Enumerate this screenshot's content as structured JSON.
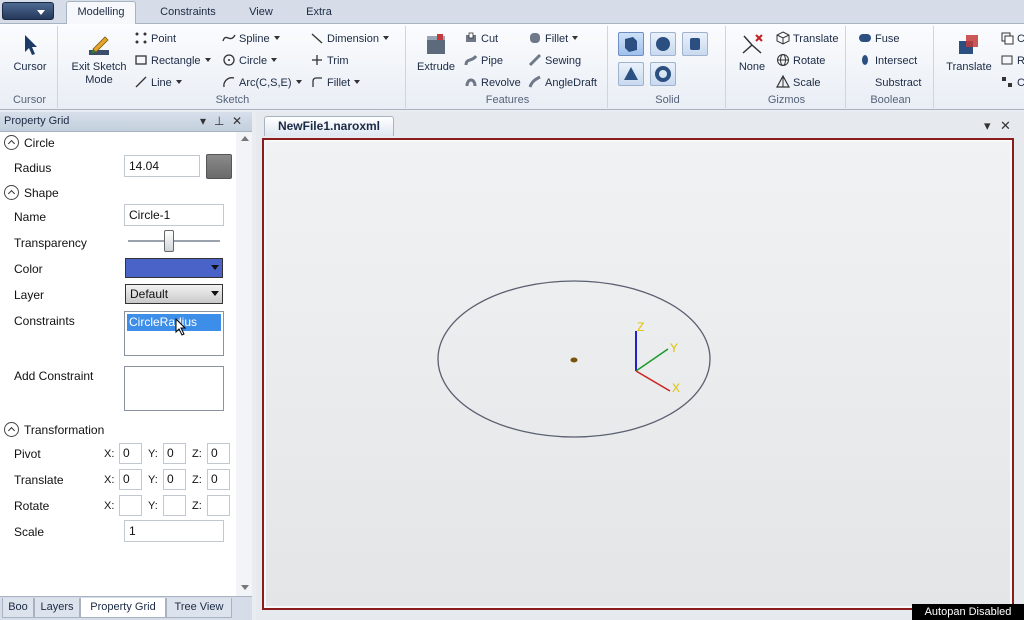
{
  "tabs": [
    "Modelling",
    "Constraints",
    "View",
    "Extra"
  ],
  "ribbon": {
    "cursor": {
      "button": "Cursor",
      "group": "Cursor"
    },
    "sketch": {
      "group": "Sketch",
      "exit_line1": "Exit Sketch",
      "exit_line2": "Mode",
      "point": "Point",
      "rectangle": "Rectangle",
      "line": "Line",
      "spline": "Spline",
      "circle": "Circle",
      "arc": "Arc(C,S,E)",
      "dimension": "Dimension",
      "trim": "Trim",
      "fillet": "Fillet"
    },
    "features": {
      "group": "Features",
      "extrude": "Extrude",
      "cut": "Cut",
      "pipe": "Pipe",
      "revolve": "Revolve",
      "fillet": "Fillet",
      "sewing": "Sewing",
      "angledraft": "AngleDraft"
    },
    "solid": {
      "group": "Solid"
    },
    "gizmos": {
      "group": "Gizmos",
      "none": "None",
      "translate": "Translate",
      "rotate": "Rotate",
      "scale": "Scale"
    },
    "boolean": {
      "group": "Boolean",
      "fuse": "Fuse",
      "intersect": "Intersect",
      "substract": "Substract"
    },
    "extra": {
      "translate": "Translate",
      "c1": "C",
      "c2": "R",
      "c3": "C"
    }
  },
  "property_grid": {
    "title": "Property Grid",
    "circle_section": "Circle",
    "radius_label": "Radius",
    "radius_value": "14.04",
    "shape_section": "Shape",
    "name_label": "Name",
    "name_value": "Circle-1",
    "transparency_label": "Transparency",
    "transparency": 0.45,
    "color_label": "Color",
    "color_value": "#4a63c9",
    "layer_label": "Layer",
    "layer_value": "Default",
    "constraints_label": "Constraints",
    "constraints_item": "CircleRadius",
    "add_constraint_label": "Add Constraint",
    "transformation_section": "Transformation",
    "pivot_label": "Pivot",
    "translate_label": "Translate",
    "rotate_label": "Rotate",
    "scale_label": "Scale",
    "axis_x": "X:",
    "axis_y": "Y:",
    "axis_z": "Z:",
    "pivot": [
      "0",
      "0",
      "0"
    ],
    "translate": [
      "0",
      "0",
      "0"
    ],
    "rotate": [
      "",
      "",
      ""
    ],
    "scale_value": "1"
  },
  "bottom_tabs": [
    "Boo",
    "Layers",
    "Property Grid",
    "Tree View"
  ],
  "document": {
    "tab": "NewFile1.naroxml",
    "axis_x": "X",
    "axis_y": "Y",
    "axis_z": "Z"
  },
  "status": "Autopan Disabled",
  "colors": {
    "accent": "#3b5ba8",
    "viewport_border": "#8b1c1c",
    "circle_stroke": "#5a6070"
  }
}
